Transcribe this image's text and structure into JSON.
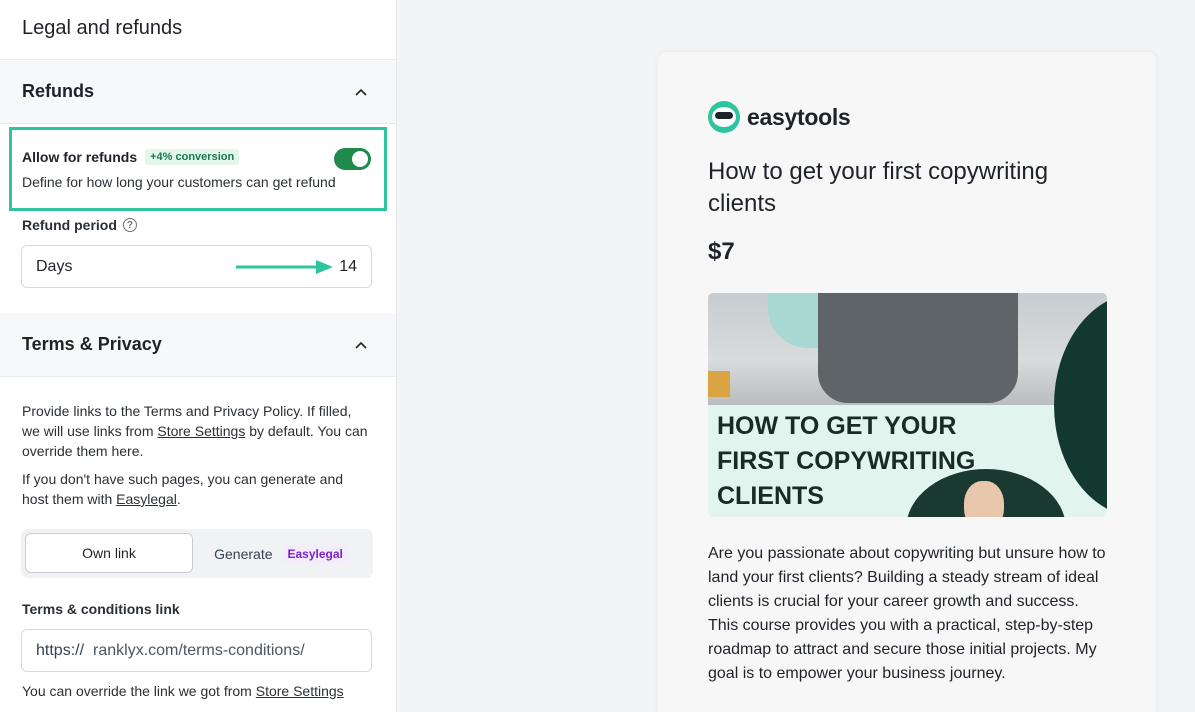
{
  "panel": {
    "title": "Legal and refunds"
  },
  "refunds": {
    "section_title": "Refunds",
    "allow_label": "Allow for refunds",
    "conversion_badge": "+4% conversion",
    "allow_enabled": true,
    "allow_description": "Define for how long your customers can get refund",
    "period_label": "Refund period",
    "period_unit": "Days",
    "period_value": "14"
  },
  "terms": {
    "section_title": "Terms & Privacy",
    "para1_a": "Provide links to the Terms and Privacy Policy. If filled, we will use links from ",
    "para1_link": "Store Settings",
    "para1_b": " by default. You can override them here.",
    "para2_a": "If you don't have such pages, you can generate and host them with ",
    "para2_link": "Easylegal",
    "para2_b": ".",
    "tab_own": "Own link",
    "tab_generate": "Generate",
    "tab_brand": "Easylegal",
    "conditions_label": "Terms & conditions link",
    "url_prefix": "https://",
    "url_value": "ranklyx.com/terms-conditions/",
    "override_a": "You can override the link we got from ",
    "override_link": "Store Settings"
  },
  "preview": {
    "brand": "easytools",
    "product_title": "How to get your first copywriting clients",
    "price": "$7",
    "cover_lines": [
      "HOW TO GET YOUR",
      "FIRST COPYWRITING",
      "CLIENTS"
    ],
    "description": "Are you passionate about copywriting but unsure how to land your first clients? Building a steady stream of ideal clients is crucial for your career growth and success. This course provides you with a practical, step-by-step roadmap to attract and secure those initial projects. My goal is to empower your business journey."
  },
  "colors": {
    "accent": "#2ec4a0",
    "toggle_on": "#1e8a4c",
    "badge_text": "#18794e",
    "brand_purple": "#7e22ce"
  }
}
